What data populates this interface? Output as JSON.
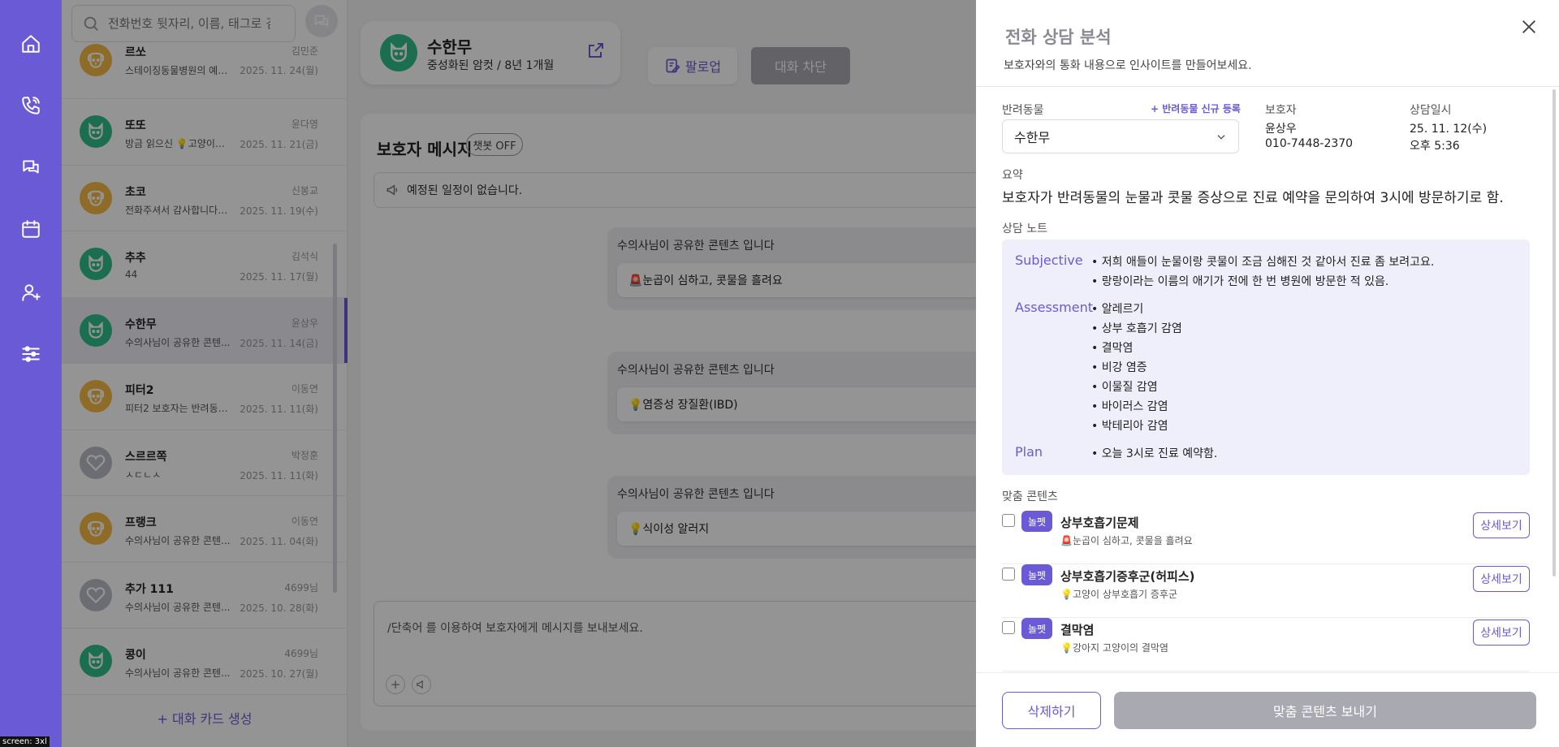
{
  "search": {
    "placeholder": "전화번호 뒷자리, 이름, 태그로 검색"
  },
  "chat_list": {
    "items": [
      {
        "name": "르쏘",
        "owner": "김민준",
        "message": "스테이징동물병원의 예신...",
        "date": "2025. 11. 24(월)",
        "avatar": "dog-icon"
      },
      {
        "name": "또또",
        "owner": "윤다영",
        "message": "방금 읽으신 💡고양이의 ...",
        "date": "2025. 11. 21(금)",
        "avatar": "cat-icon"
      },
      {
        "name": "초코",
        "owner": "신봉교",
        "message": "전화주셔서 감사합니다. ...",
        "date": "2025. 11. 19(수)",
        "avatar": "dog-icon"
      },
      {
        "name": "추추",
        "owner": "김석식",
        "message": "44",
        "date": "2025. 11. 17(월)",
        "avatar": "cat-icon"
      },
      {
        "name": "수한무",
        "owner": "윤상우",
        "message": "수의사님이 공유한 콘텐...",
        "date": "2025. 11. 14(금)",
        "avatar": "cat-icon",
        "active": true
      },
      {
        "name": "피터2",
        "owner": "이동연",
        "message": "피터2 보호자는 반려동물...",
        "date": "2025. 11. 11(화)",
        "avatar": "dog-icon"
      },
      {
        "name": "스르르쪽",
        "owner": "박정훈",
        "message": "ㅅㄷㄴㅅ",
        "date": "2025. 11. 11(화)",
        "avatar": "heart-icon"
      },
      {
        "name": "프랭크",
        "owner": "이동연",
        "message": "수의사님이 공유한 콘텐...",
        "date": "2025. 11. 04(화)",
        "avatar": "dog-icon"
      },
      {
        "name": "추가 111",
        "owner": "4699님",
        "message": "수의사님이 공유한 콘텐...",
        "date": "2025. 10. 28(화)",
        "avatar": "heart-icon"
      },
      {
        "name": "콩이",
        "owner": "4699님",
        "message": "수의사님이 공유한 콘텐...",
        "date": "2025. 10. 27(월)",
        "avatar": "cat-icon"
      }
    ],
    "new_card_label": "+ 대화 카드 생성"
  },
  "pet_card": {
    "name": "수한무",
    "info": "중성화된 암컷 /  8년 1개월"
  },
  "toolbar": {
    "follow_label": "팔로업",
    "block_label": "대화 차단"
  },
  "messages": {
    "title": "보호자 메시지",
    "bot_toggle": "챗봇 OFF",
    "schedule": "예정된 일정이 없습니다.",
    "bubbles": [
      {
        "title": "수의사님이 공유한 콘텐츠 입니다",
        "content": "🚨눈곱이 심하고, 콧물을 흘려요"
      },
      {
        "title": "수의사님이 공유한 콘텐츠 입니다",
        "content": "💡염증성 장질환(IBD)"
      },
      {
        "title": "수의사님이 공유한 콘텐츠 입니다",
        "content": "💡식이성 알러지"
      }
    ],
    "composer_placeholder": "/단축어 를 이용하여 보호자에게 메시지를 보내보세요."
  },
  "drawer": {
    "title": "전화 상담 분석",
    "subtitle": "보호자와의 통화 내용으로 인사이트를 만들어보세요.",
    "pet_label": "반려동물",
    "add_pet": "+ 반려동물 신규 등록",
    "pet_value": "수한무",
    "guardian_label": "보호자",
    "guardian_name": "윤상우",
    "guardian_phone": "010-7448-2370",
    "datetime_label": "상담일시",
    "date": "25. 11. 12(수)",
    "time": "오후 5:36",
    "summary_label": "요약",
    "summary": "보호자가 반려동물의 눈물과 콧물 증상으로 진료 예약을 문의하여 3시에 방문하기로 함.",
    "notes_label": "상담 노트",
    "notes": {
      "subjective_label": "Subjective",
      "subjective": [
        "저희 애들이 눈물이랑 콧물이 조금 심해진 것 같아서 진료 좀 보려고요.",
        "랑랑이라는 이름의 애기가 전에 한 번 병원에 방문한 적 있음."
      ],
      "assessment_label": "Assessment",
      "assessment": [
        "알레르기",
        "상부 호흡기 감염",
        "결막염",
        "비강 염증",
        "이물질 감염",
        "바이러스 감염",
        "박테리아 감염"
      ],
      "plan_label": "Plan",
      "plan": [
        "오늘 3시로 진료 예약함."
      ]
    },
    "contents_label": "맞춤 콘텐츠",
    "contents": [
      {
        "badge": "놀펫",
        "title": "상부호흡기문제",
        "sub": "🚨눈곱이 심하고, 콧물을 흘려요",
        "detail": "상세보기"
      },
      {
        "badge": "놀펫",
        "title": "상부호흡기증후군(허피스)",
        "sub": "💡고양이 상부호흡기 증후군",
        "detail": "상세보기"
      },
      {
        "badge": "놀펫",
        "title": "결막염",
        "sub": "💡강아지 고양이의 결막염",
        "detail": "상세보기"
      }
    ],
    "delete_label": "삭제하기",
    "send_label": "맞춤 콘텐츠 보내기"
  },
  "screen_tag": "screen: 3xl"
}
